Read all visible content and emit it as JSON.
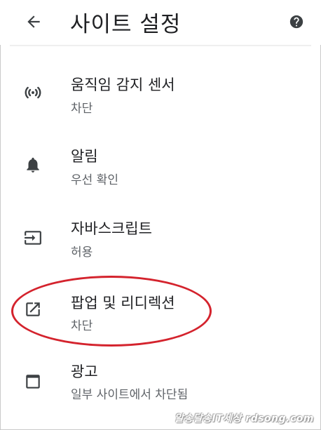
{
  "header": {
    "title": "사이트 설정",
    "back_icon": "arrow-back-icon",
    "help_icon": "help-circle-icon"
  },
  "items": [
    {
      "title": "움직임 감지 센서",
      "subtitle": "차단",
      "icon": "sensors-icon"
    },
    {
      "title": "알림",
      "subtitle": "우선 확인",
      "icon": "bell-icon"
    },
    {
      "title": "자바스크립트",
      "subtitle": "허용",
      "icon": "javascript-input-icon"
    },
    {
      "title": "팝업 및 리디렉션",
      "subtitle": "차단",
      "icon": "open-in-new-icon"
    },
    {
      "title": "광고",
      "subtitle": "일부 사이트에서 차단됨",
      "icon": "ad-window-icon"
    }
  ],
  "annotation": {
    "color": "#d4232d"
  },
  "watermark": "알송달송IT세상 rdsong.com",
  "colors": {
    "primary_text": "#202124",
    "secondary_text": "#5f6368",
    "icon": "#3c4043"
  }
}
